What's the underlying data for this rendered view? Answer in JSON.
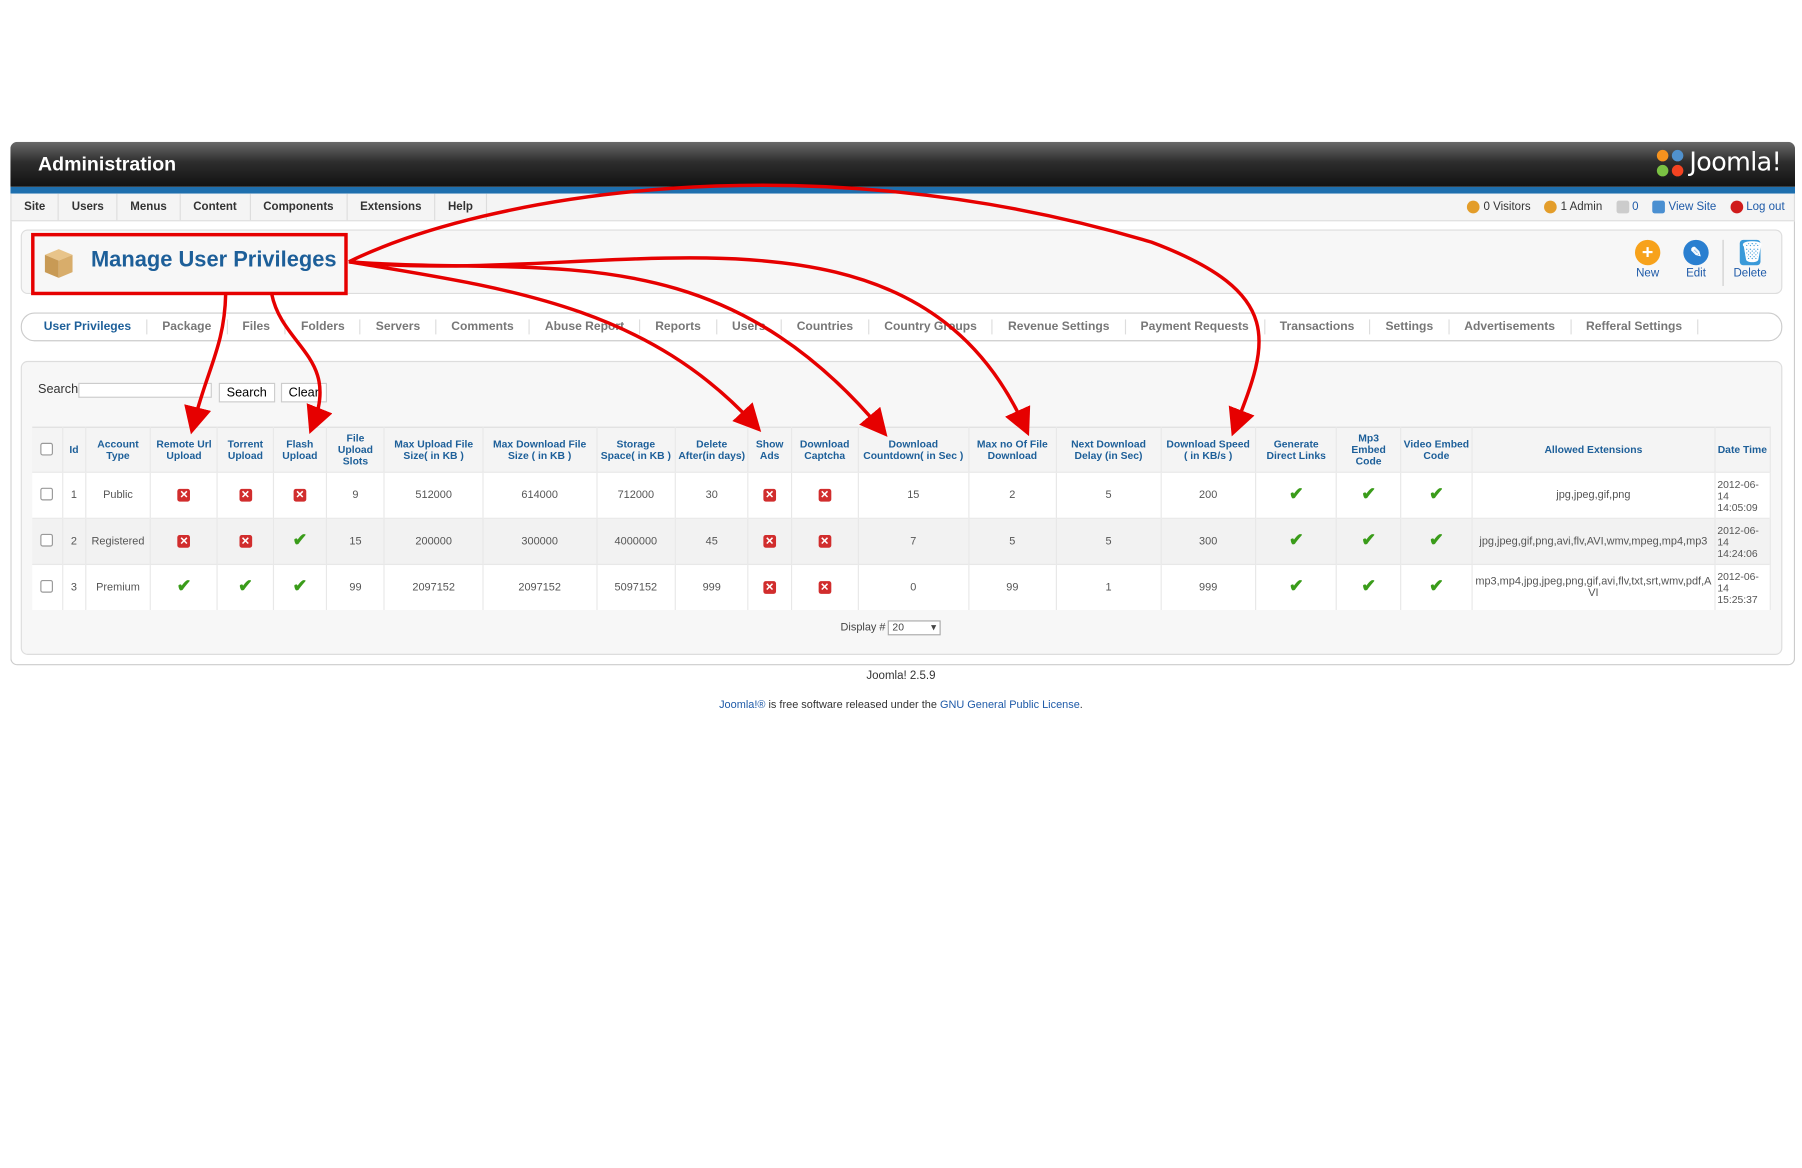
{
  "header": {
    "title": "Administration",
    "logo_text": "Joomla!"
  },
  "menubar": {
    "items": [
      "Site",
      "Users",
      "Menus",
      "Content",
      "Components",
      "Extensions",
      "Help"
    ],
    "status": {
      "visitors": "0 Visitors",
      "admins": "1 Admin",
      "messages": "0",
      "view_site": "View Site",
      "logout": "Log out"
    }
  },
  "page": {
    "title": "Manage User Privileges"
  },
  "toolbar": {
    "new_label": "New",
    "edit_label": "Edit",
    "delete_label": "Delete"
  },
  "subnav": {
    "tabs": [
      "User Privileges",
      "Package",
      "Files",
      "Folders",
      "Servers",
      "Comments",
      "Abuse Report",
      "Reports",
      "Users",
      "Countries",
      "Country Groups",
      "Revenue Settings",
      "Payment Requests",
      "Transactions",
      "Settings",
      "Advertisements",
      "Refferal Settings"
    ],
    "active": "User Privileges"
  },
  "filter": {
    "label": "Search",
    "search_value": "",
    "search_button": "Search",
    "clear_button": "Clear"
  },
  "table": {
    "headers": [
      "Id",
      "Account Type",
      "Remote Url Upload",
      "Torrent Upload",
      "Flash Upload",
      "File Upload Slots",
      "Max Upload File Size( in KB )",
      "Max Download File Size ( in KB )",
      "Storage Space( in KB )",
      "Delete After(in days)",
      "Show Ads",
      "Download Captcha",
      "Download Countdown( in Sec )",
      "Max no Of File Download",
      "Next Download Delay (in Sec)",
      "Download Speed ( in KB/s )",
      "Generate Direct Links",
      "Mp3 Embed Code",
      "Video Embed Code",
      "Allowed Extensions",
      "Date Time"
    ],
    "rows": [
      {
        "id": "1",
        "account_type": "Public",
        "remote": false,
        "torrent": false,
        "flash": false,
        "slots": "9",
        "max_upload": "512000",
        "max_download": "614000",
        "storage": "712000",
        "delete_after": "30",
        "show_ads": false,
        "captcha": false,
        "countdown": "15",
        "max_files": "2",
        "next_delay": "5",
        "speed": "200",
        "direct_links": true,
        "mp3": true,
        "video": true,
        "extensions": "jpg,jpeg,gif,png",
        "date": "2012-06-14 14:05:09"
      },
      {
        "id": "2",
        "account_type": "Registered",
        "remote": false,
        "torrent": false,
        "flash": true,
        "slots": "15",
        "max_upload": "200000",
        "max_download": "300000",
        "storage": "4000000",
        "delete_after": "45",
        "show_ads": false,
        "captcha": false,
        "countdown": "7",
        "max_files": "5",
        "next_delay": "5",
        "speed": "300",
        "direct_links": true,
        "mp3": true,
        "video": true,
        "extensions": "jpg,jpeg,gif,png,avi,flv,AVI,wmv,mpeg,mp4,mp3",
        "date": "2012-06-14 14:24:06"
      },
      {
        "id": "3",
        "account_type": "Premium",
        "remote": true,
        "torrent": true,
        "flash": true,
        "slots": "99",
        "max_upload": "2097152",
        "max_download": "2097152",
        "storage": "5097152",
        "delete_after": "999",
        "show_ads": false,
        "captcha": false,
        "countdown": "0",
        "max_files": "99",
        "next_delay": "1",
        "speed": "999",
        "direct_links": true,
        "mp3": true,
        "video": true,
        "extensions": "mp3,mp4,jpg,jpeg,png,gif,avi,flv,txt,srt,wmv,pdf,AVI",
        "date": "2012-06-14 15:25:37"
      }
    ]
  },
  "pager": {
    "label": "Display #",
    "value": "20"
  },
  "footer": {
    "version": "Joomla! 2.5.9",
    "license_pre": "Joomla!®",
    "license_mid": " is free software released under the ",
    "license_link": "GNU General Public License",
    "license_post": "."
  },
  "colors": {
    "accent": "#1d5f99",
    "annotation": "#e60000",
    "header_bar": "#1e6fae"
  }
}
